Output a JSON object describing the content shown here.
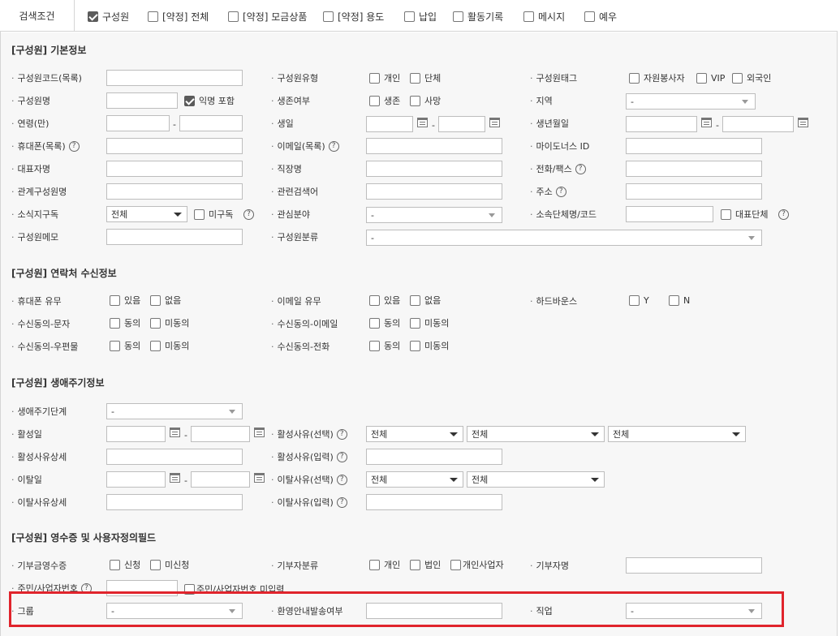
{
  "top": {
    "label": "검색조건",
    "options": [
      {
        "label": "구성원",
        "checked": true
      },
      {
        "label": "[약정] 전체",
        "checked": false
      },
      {
        "label": "[약정] 모금상품",
        "checked": false
      },
      {
        "label": "[약정] 용도",
        "checked": false
      },
      {
        "label": "납입",
        "checked": false
      },
      {
        "label": "활동기록",
        "checked": false
      },
      {
        "label": "메시지",
        "checked": false
      },
      {
        "label": "예우",
        "checked": false
      }
    ]
  },
  "s1": {
    "title": "[구성원] 기본정보",
    "member_code": "구성원코드(목록)",
    "member_type": "구성원유형",
    "type_individual": "개인",
    "type_group": "단체",
    "member_tag": "구성원태그",
    "tag_volunteer": "자원봉사자",
    "tag_vip": "VIP",
    "tag_foreigner": "외국인",
    "member_name": "구성원명",
    "anonymous": "익명 포함",
    "alive": "생존여부",
    "alive_yes": "생존",
    "alive_no": "사망",
    "region": "지역",
    "region_value": "-",
    "age": "연령(만)",
    "birthday": "생일",
    "birthdate": "생년월일",
    "mobile": "휴대폰(목록)",
    "email": "이메일(목록)",
    "mind_id": "마이도너스 ID",
    "rep_name": "대표자명",
    "company": "직장명",
    "phone_fax": "전화/팩스",
    "relation": "관계구성원명",
    "related_keyword": "관련검색어",
    "address": "주소",
    "newsletter": "소식지구독",
    "newsletter_value": "전체",
    "unsubscribed": "미구독",
    "interest": "관심분야",
    "interest_value": "-",
    "org_code": "소속단체명/코드",
    "rep_org": "대표단체",
    "memo": "구성원메모",
    "category": "구성원분류",
    "category_value": "-",
    "dash": "-"
  },
  "s2": {
    "title": "[구성원] 연락처 수신정보",
    "mobile_exists": "휴대폰 유무",
    "email_exists": "이메일 유무",
    "hard_bounce": "하드바운스",
    "has": "있음",
    "none": "없음",
    "yes": "Y",
    "no": "N",
    "consent_sms": "수신동의-문자",
    "consent_email": "수신동의-이메일",
    "consent_mail": "수신동의-우편물",
    "consent_phone": "수신동의-전화",
    "agree": "동의",
    "disagree": "미동의"
  },
  "s3": {
    "title": "[구성원] 생애주기정보",
    "stage": "생애주기단계",
    "stage_value": "-",
    "active_date": "활성일",
    "active_reason_sel": "활성사유(선택)",
    "all": "전체",
    "active_reason_detail": "활성사유상세",
    "active_reason_input": "활성사유(입력)",
    "leave_date": "이탈일",
    "leave_reason_sel": "이탈사유(선택)",
    "leave_reason_detail": "이탈사유상세",
    "leave_reason_input": "이탈사유(입력)",
    "dash": "-"
  },
  "s4": {
    "title": "[구성원] 영수증 및 사용자정의필드",
    "receipt": "기부금영수증",
    "applied": "신청",
    "not_applied": "미신청",
    "donor_type": "기부자분류",
    "individual": "개인",
    "corporate": "법인",
    "individual_biz": "개인사업자",
    "donor_name": "기부자명",
    "resident_no": "주민/사업자번호",
    "resident_no_missing": "주민/사업자번호 미입력",
    "group": "그룹",
    "group_value": "-",
    "welcome": "환영안내발송여부",
    "job": "직업",
    "job_value": "-"
  }
}
